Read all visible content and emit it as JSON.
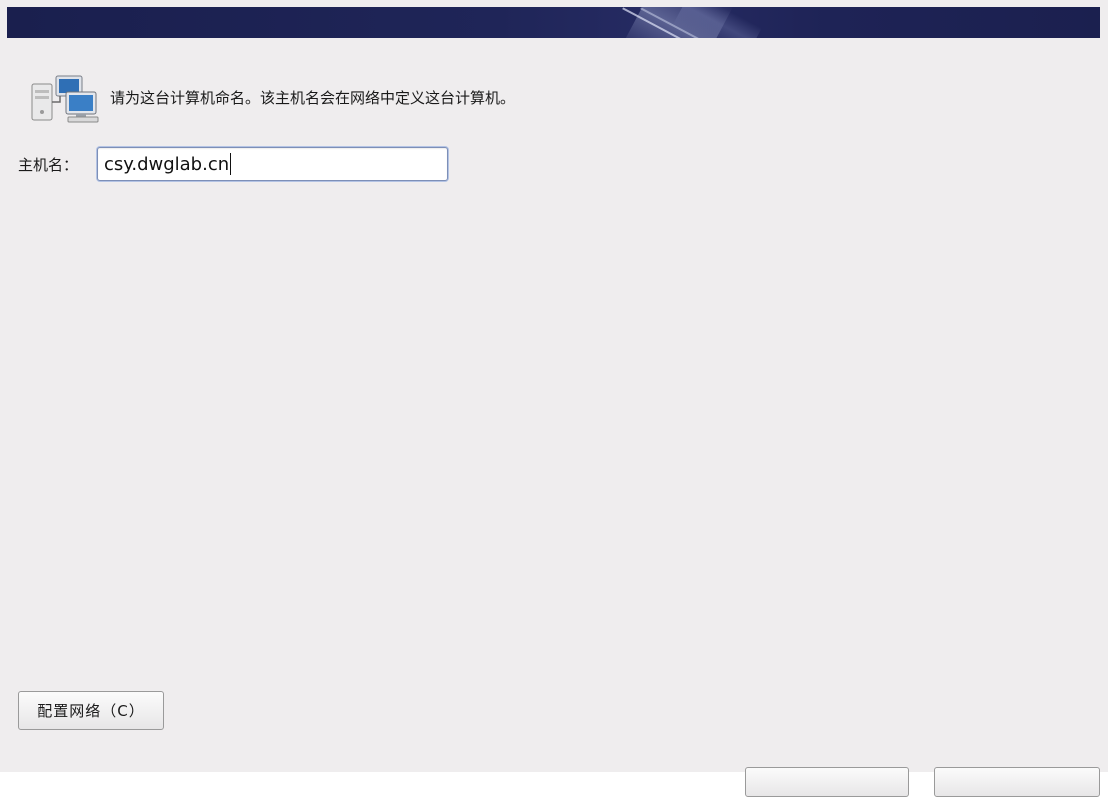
{
  "header": {
    "banner_icon": "installer-banner"
  },
  "intro": {
    "icon": "networked-computers-icon",
    "text": "请为这台计算机命名。该主机名会在网络中定义这台计算机。"
  },
  "hostname": {
    "label": "主机名：",
    "value": "csy.dwglab.cn"
  },
  "buttons": {
    "configure_network_label": "配置网络（C）",
    "back_label": "",
    "next_label": ""
  },
  "colors": {
    "banner": "#1f2558",
    "background": "#efedee",
    "input_focus_border": "#7d8fb7"
  }
}
